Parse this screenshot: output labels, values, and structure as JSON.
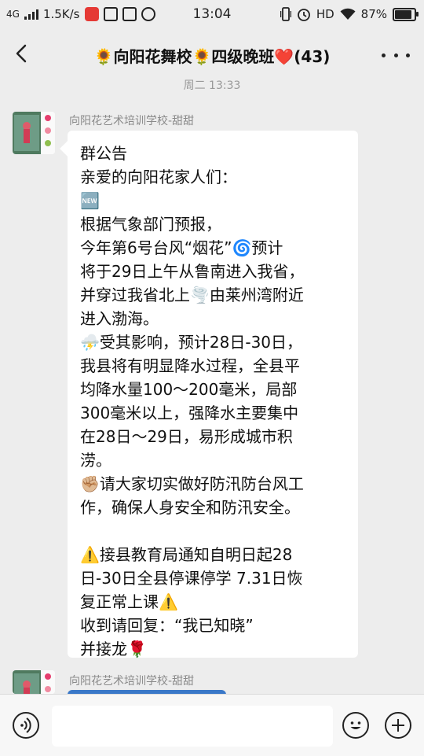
{
  "status_bar": {
    "network": "4G",
    "speed": "1.5K/s",
    "time": "13:04",
    "hd": "HD",
    "battery": "87%"
  },
  "header": {
    "title": "🌻向阳花舞校🌻四级晚班❤️(43)"
  },
  "chat": {
    "timestamp": "周二 13:33",
    "messages": [
      {
        "sender": "向阳花艺术培训学校-甜甜",
        "lines": [
          "群公告",
          "亲爱的向阳花家人们：",
          "🆕",
          "根据气象部门预报，",
          "今年第6号台风“烟花”🌀预计",
          "将于29日上午从鲁南进入我省，",
          "并穿过我省北上🌪️由莱州湾附近",
          "进入渤海。",
          "⛈️受其影响，预计28日-30日，",
          "我县将有明显降水过程，全县平",
          "均降水量100～200毫米，局部",
          "300毫米以上，强降水主要集中",
          "在28日～29日，易形成城市积",
          "涝。",
          "✊🏼请大家切实做好防汛防台风工",
          "作，确保人身安全和防汛安全。",
          "",
          "⚠️接县教育局通知自明日起28",
          "日-30日全县停课停学 7.31日恢",
          "复正常上课⚠️",
          "收到请回复：“我已知晓”",
          "并接龙🌹"
        ]
      },
      {
        "sender": "向阳花艺术培训学校-甜甜"
      }
    ]
  },
  "colors": {
    "background": "#ededed",
    "bubble": "#ffffff",
    "sender_text": "#8a8a8a"
  }
}
